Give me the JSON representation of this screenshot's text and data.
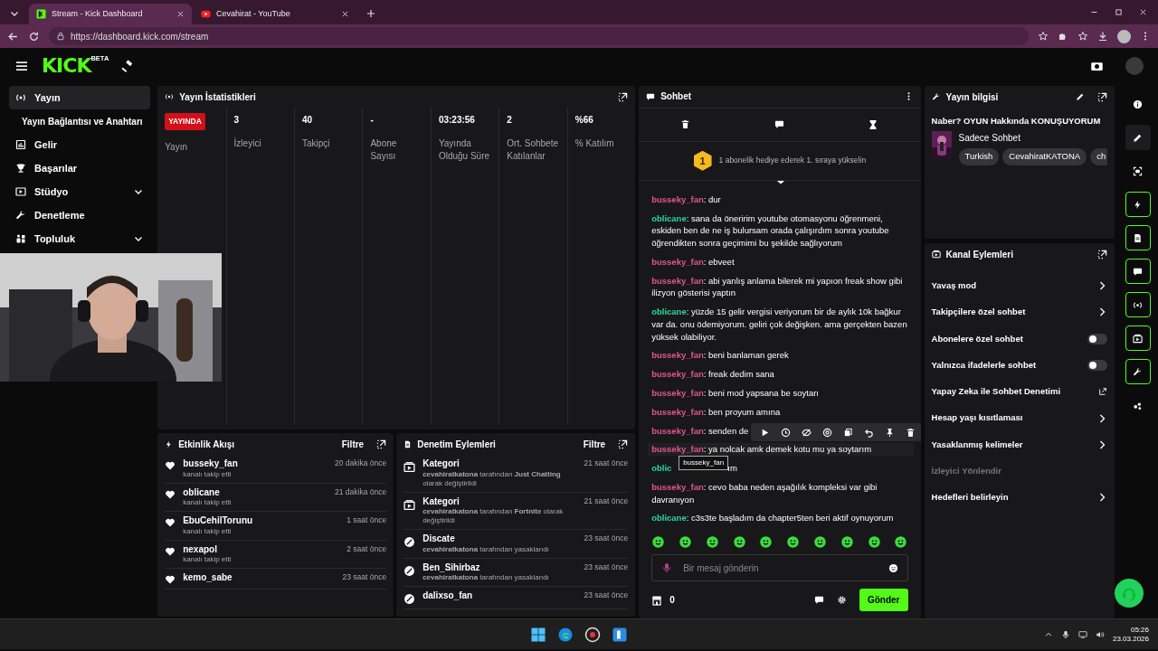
{
  "browser": {
    "tabs": [
      {
        "title": "Stream - Kick Dashboard",
        "selected": true,
        "kind": "kick"
      },
      {
        "title": "Cevahirat - YouTube",
        "selected": false,
        "kind": "youtube"
      }
    ],
    "url": "https://dashboard.kick.com/stream"
  },
  "header": {
    "logo": "KICK",
    "logo_badge": "BETA"
  },
  "sidebar": {
    "items": [
      {
        "label": "Yayın",
        "selected": true,
        "expandable": false
      },
      {
        "label": "Yayın Bağlantısı ve Anahtarı",
        "selected": false,
        "expandable": false
      },
      {
        "label": "Gelir",
        "selected": false,
        "expandable": false
      },
      {
        "label": "Başarılar",
        "selected": false,
        "expandable": false
      },
      {
        "label": "Stüdyo",
        "selected": false,
        "expandable": true
      },
      {
        "label": "Denetleme",
        "selected": false,
        "expandable": false
      },
      {
        "label": "Topluluk",
        "selected": false,
        "expandable": true
      }
    ]
  },
  "stats": {
    "title": "Yayın İstatistikleri",
    "live_badge": "YAYINDA",
    "live_label": "Yayın",
    "items": [
      {
        "value": "3",
        "label": "İzleyici"
      },
      {
        "value": "40",
        "label": "Takipçi"
      },
      {
        "value": "-",
        "label": "Abone Sayısı"
      },
      {
        "value": "03:23:56",
        "label": "Yayında Olduğu Süre"
      },
      {
        "value": "2",
        "label": "Ort. Sohbete Katılanlar"
      },
      {
        "value": "%66",
        "label": "% Katılım"
      }
    ]
  },
  "activity": {
    "title": "Etkinlik Akışı",
    "filter": "Filtre",
    "items": [
      {
        "name": "busseky_fan",
        "time": "20 dakika önce",
        "action": "kanalı takip etti"
      },
      {
        "name": "oblicane",
        "time": "21 dakika önce",
        "action": "kanalı takip etti"
      },
      {
        "name": "EbuCehilTorunu",
        "time": "1 saat önce",
        "action": "kanalı takip etti"
      },
      {
        "name": "nexapol",
        "time": "2 saat önce",
        "action": "kanalı takip etti"
      },
      {
        "name": "kemo_sabe",
        "time": "23 saat önce"
      }
    ]
  },
  "moderation": {
    "title": "Denetim Eylemleri",
    "filter": "Filtre",
    "items": [
      {
        "kind": "category",
        "title": "Kategori",
        "time": "21 saat önce",
        "detail": "**cevahiratkatona** tarafından **Just Chatting** olarak değiştirildi"
      },
      {
        "kind": "category",
        "title": "Kategori",
        "time": "21 saat önce",
        "detail": "**cevahiratkatona** tarafından **Fortnite** olarak değiştirildi"
      },
      {
        "kind": "ban",
        "title": "Discate",
        "time": "23 saat önce",
        "detail": "**cevahiratkatona** tarafından yasaklandı"
      },
      {
        "kind": "ban",
        "title": "Ben_Sihirbaz",
        "time": "23 saat önce",
        "detail": "**cevahiratkatona** tarafından yasaklandı"
      },
      {
        "kind": "ban",
        "title": "dalixso_fan",
        "time": "23 saat önce"
      }
    ]
  },
  "chat": {
    "title": "Sohbet",
    "promo_rank": "1",
    "promo": "1 abonelik hediye ederek 1. sıraya yükselin",
    "messages": [
      {
        "author": "busseky_fan",
        "color": "#e0578b",
        "text": ": dur",
        "hovered": false
      },
      {
        "author": "oblicane",
        "color": "#2bd69b",
        "text": ": sana da öneririm youtube otomasyonu öğrenmeni, eskiden ben de ne iş bulursam orada çalışırdım sonra youtube öğrendikten sonra geçimimi bu şekilde sağlıyorum",
        "hovered": false
      },
      {
        "author": "busseky_fan",
        "color": "#e0578b",
        "text": ": ebveet",
        "hovered": false
      },
      {
        "author": "busseky_fan",
        "color": "#e0578b",
        "text": ": abi yanlış anlama bilerek mi yapıon freak show gibi ilizyon gösterisi yaptın",
        "hovered": false
      },
      {
        "author": "oblicane",
        "color": "#2bd69b",
        "text": ": yüzde 15 gelir vergisi veriyorum bir de aylık 10k bağkur var da. onu ödemiyorum. geliri çok değişken. ama gerçekten bazen yüksek olabiliyor.",
        "hovered": false
      },
      {
        "author": "busseky_fan",
        "color": "#e0578b",
        "text": ": beni banlaman gerek",
        "hovered": false
      },
      {
        "author": "busseky_fan",
        "color": "#e0578b",
        "text": ": freak dedim sana",
        "hovered": false
      },
      {
        "author": "busseky_fan",
        "color": "#e0578b",
        "text": ": beni mod yapsana be soytarı",
        "hovered": false
      },
      {
        "author": "busseky_fan",
        "color": "#e0578b",
        "text": ": ben proyum amına",
        "hovered": false
      },
      {
        "author": "busseky_fan",
        "color": "#e0578b",
        "text": ": senden de",
        "hovered": false
      },
      {
        "author": "busseky_fan",
        "color": "#e0578b",
        "text": ": ya nolcak amk demek kotu mu ya soytarım",
        "hovered": true
      },
      {
        "author": "oblic",
        "color": "#2bd69b",
        "text": "ım",
        "hovered": false
      },
      {
        "author": "busseky_fan",
        "color": "#e0578b",
        "text": ": cevo baba neden aşağılık kompleksi var gibi davranıyon",
        "hovered": false
      },
      {
        "author": "oblicane",
        "color": "#2bd69b",
        "text": ": c3s3te başladım da chapter5ten beri aktif oynuyorum",
        "hovered": false
      }
    ],
    "tooltip": "busseky_fan",
    "placeholder": "Bir mesaj gönderin",
    "points": "0",
    "send": "Gönder"
  },
  "stream_info": {
    "title": "Yayın bilgisi",
    "stream_title": "Naber? OYUN Hakkında KONUŞUYORUM",
    "category": "Sadece Sohbet",
    "tags": [
      "Turkish",
      "CevahiratKATONA",
      "ch"
    ]
  },
  "channel_actions": {
    "title": "Kanal Eylemleri",
    "items": [
      {
        "label": "Yavaş mod",
        "kind": "arrow",
        "disabled": false
      },
      {
        "label": "Takipçilere özel sohbet",
        "kind": "arrow",
        "disabled": false
      },
      {
        "label": "Abonelere özel sohbet",
        "kind": "toggle",
        "on": false,
        "disabled": false
      },
      {
        "label": "Yalnızca ifadelerle sohbet",
        "kind": "toggle",
        "on": false,
        "disabled": false
      },
      {
        "label": "Yapay Zeka ile Sohbet Denetimi",
        "kind": "external",
        "disabled": false
      },
      {
        "label": "Hesap yaşı kısıtlaması",
        "kind": "arrow",
        "disabled": false
      },
      {
        "label": "Yasaklanmış kelimeler",
        "kind": "arrow",
        "disabled": false
      },
      {
        "label": "İzleyici Yönlendir",
        "kind": "none",
        "disabled": true
      },
      {
        "label": "Hedefleri belirleyin",
        "kind": "arrow",
        "disabled": false
      }
    ]
  },
  "taskbar": {
    "time": "05:26",
    "date": "23.03.2026"
  }
}
